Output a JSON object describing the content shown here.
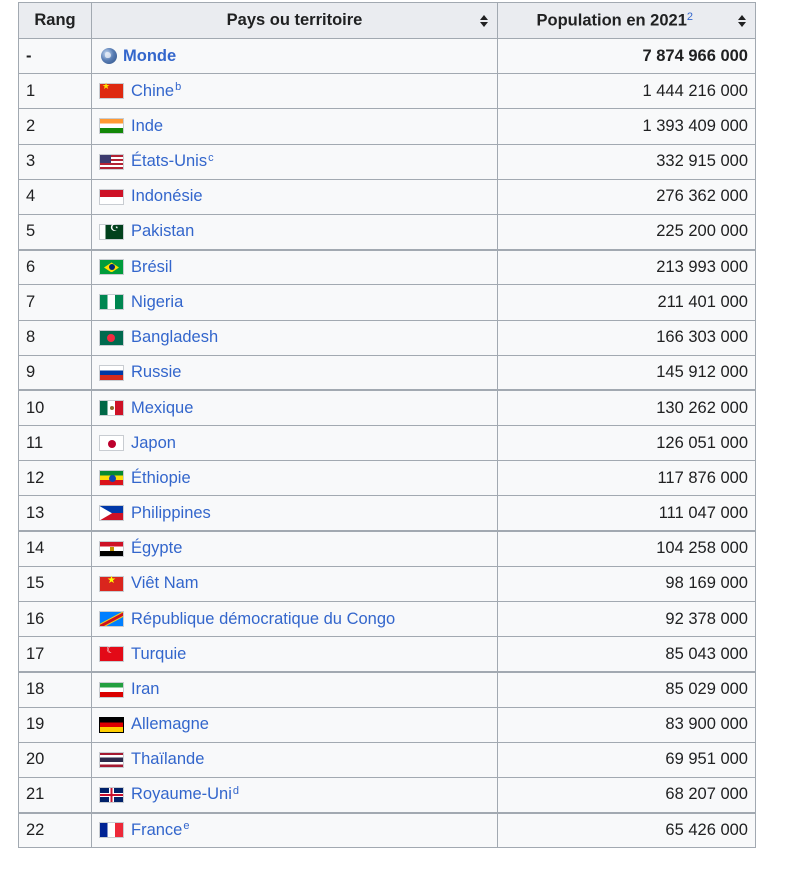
{
  "headers": {
    "rank": "Rang",
    "country": "Pays ou territoire",
    "population": "Population en 2021",
    "population_note": "2"
  },
  "world": {
    "rank": "-",
    "name": "Monde",
    "population": "7 874 966 000",
    "icon": "globe-icon"
  },
  "rows": [
    {
      "rank": "1",
      "name": "Chine",
      "note": "b",
      "population": "1 444 216 000",
      "flag": "cn"
    },
    {
      "rank": "2",
      "name": "Inde",
      "note": "",
      "population": "1 393 409 000",
      "flag": "in"
    },
    {
      "rank": "3",
      "name": "États-Unis",
      "note": "c",
      "population": "332 915 000",
      "flag": "us"
    },
    {
      "rank": "4",
      "name": "Indonésie",
      "note": "",
      "population": "276 362 000",
      "flag": "id"
    },
    {
      "rank": "5",
      "name": "Pakistan",
      "note": "",
      "population": "225 200 000",
      "flag": "pk"
    },
    {
      "rank": "6",
      "name": "Brésil",
      "note": "",
      "population": "213 993 000",
      "flag": "br"
    },
    {
      "rank": "7",
      "name": "Nigeria",
      "note": "",
      "population": "211 401 000",
      "flag": "ng"
    },
    {
      "rank": "8",
      "name": "Bangladesh",
      "note": "",
      "population": "166 303 000",
      "flag": "bd"
    },
    {
      "rank": "9",
      "name": "Russie",
      "note": "",
      "population": "145 912 000",
      "flag": "ru"
    },
    {
      "rank": "10",
      "name": "Mexique",
      "note": "",
      "population": "130 262 000",
      "flag": "mx"
    },
    {
      "rank": "11",
      "name": "Japon",
      "note": "",
      "population": "126 051 000",
      "flag": "jp"
    },
    {
      "rank": "12",
      "name": "Éthiopie",
      "note": "",
      "population": "117 876 000",
      "flag": "et"
    },
    {
      "rank": "13",
      "name": "Philippines",
      "note": "",
      "population": "111 047 000",
      "flag": "ph"
    },
    {
      "rank": "14",
      "name": "Égypte",
      "note": "",
      "population": "104 258 000",
      "flag": "eg"
    },
    {
      "rank": "15",
      "name": "Viêt Nam",
      "note": "",
      "population": "98 169 000",
      "flag": "vn"
    },
    {
      "rank": "16",
      "name": "République démocratique du Congo",
      "note": "",
      "population": "92 378 000",
      "flag": "cd"
    },
    {
      "rank": "17",
      "name": "Turquie",
      "note": "",
      "population": "85 043 000",
      "flag": "tr"
    },
    {
      "rank": "18",
      "name": "Iran",
      "note": "",
      "population": "85 029 000",
      "flag": "ir"
    },
    {
      "rank": "19",
      "name": "Allemagne",
      "note": "",
      "population": "83 900 000",
      "flag": "de"
    },
    {
      "rank": "20",
      "name": "Thaïlande",
      "note": "",
      "population": "69 951 000",
      "flag": "th"
    },
    {
      "rank": "21",
      "name": "Royaume-Uni",
      "note": "d",
      "population": "68 207 000",
      "flag": "gb"
    },
    {
      "rank": "22",
      "name": "France",
      "note": "e",
      "population": "65 426 000",
      "flag": "fr"
    }
  ],
  "colors": {
    "link": "#3366cc",
    "header_bg": "#eaecf0",
    "cell_bg": "#f8f9fa",
    "border": "#a2a9b1"
  }
}
